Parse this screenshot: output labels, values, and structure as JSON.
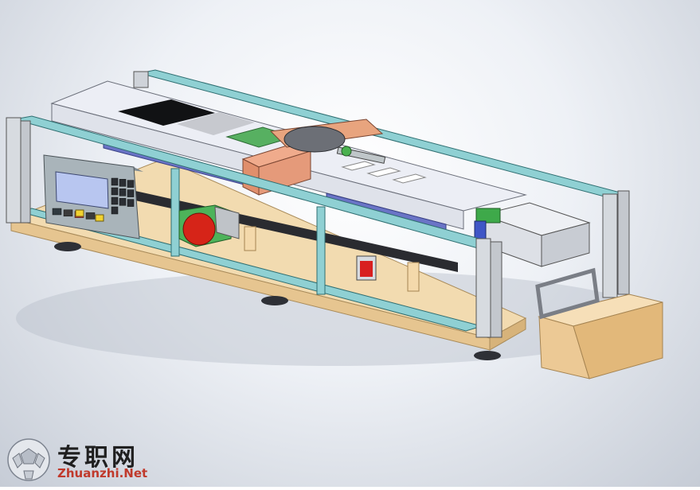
{
  "watermark": {
    "cn_text": "专职网",
    "url_text": "Zhuanzhi.Net"
  },
  "colors": {
    "frame_teal": "#7ec6c9",
    "wood_base": "#f0d6a8",
    "housing_white": "#eaedf5",
    "control_panel": "#a9b4ba",
    "screw_blue": "#5b64b8",
    "emergency_red": "#d62418",
    "emergency_green": "#58a85a",
    "carriage_salmon": "#e59a7a",
    "watermark_red": "#c0392b"
  },
  "keypad_keys": [
    "F1",
    "F2",
    "F3",
    "F4",
    "1",
    "2",
    "3",
    "4",
    "5",
    "6",
    "7",
    "8",
    "9",
    "0"
  ]
}
